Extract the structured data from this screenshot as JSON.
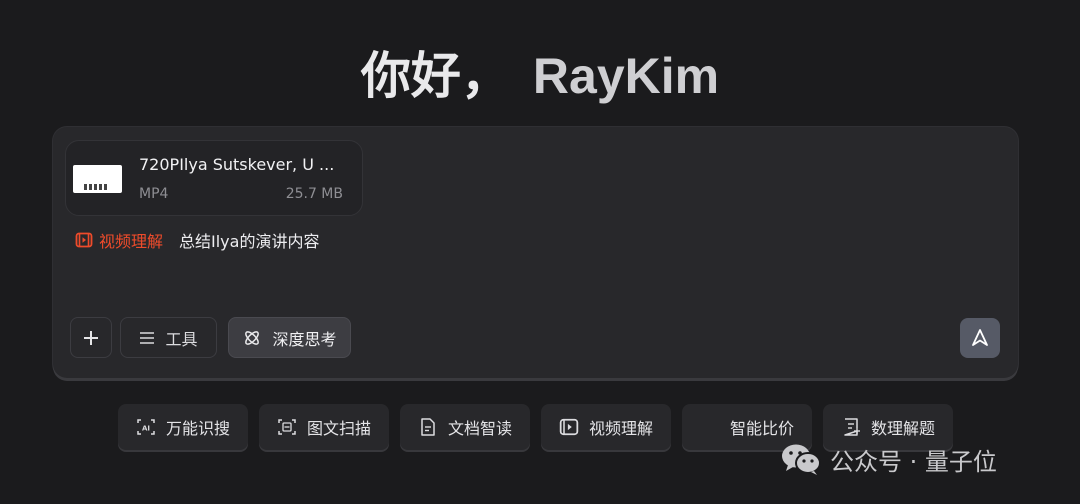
{
  "greeting": {
    "hello": "你好，",
    "name": "RayKim"
  },
  "attachment": {
    "name": "720PIlya Sutskever, U ...",
    "type": "MP4",
    "size": "25.7 MB"
  },
  "prompt": {
    "tag": "视频理解",
    "text": "总结Ilya的演讲内容"
  },
  "toolbar": {
    "plus": "+",
    "tools": "工具",
    "deep_think": "深度思考"
  },
  "chips": [
    "万能识搜",
    "图文扫描",
    "文档智读",
    "视频理解",
    "智能比价",
    "数理解题"
  ],
  "watermark": "公众号 · 量子位",
  "colors": {
    "background": "#1b1b1d",
    "panel": "#28282b",
    "accent": "#ee4b2b",
    "send": "#565a66"
  }
}
